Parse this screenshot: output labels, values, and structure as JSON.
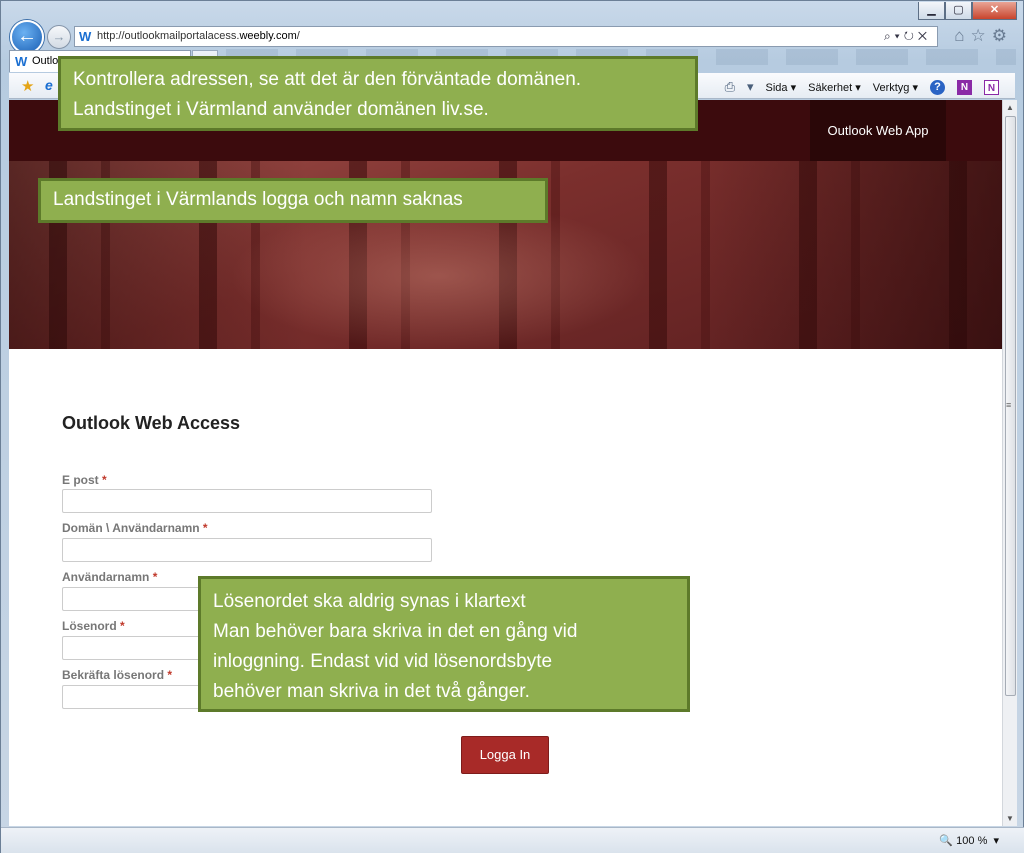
{
  "browser": {
    "url_prefix": "http://outlookmailportalacess.",
    "url_domain": "weebly.com",
    "url_suffix": "/",
    "tab_title": "Outlo",
    "commands": {
      "sida": "Sida ▾",
      "sakerhet": "Säkerhet ▾",
      "verktyg": "Verktyg ▾"
    },
    "zoom": "100 %"
  },
  "site": {
    "nav_link": "Outlook Web App"
  },
  "form": {
    "title": "Outlook Web Access",
    "required_mark": "*",
    "fields": [
      {
        "label": "E post"
      },
      {
        "label": "Domän \\ Användarnamn"
      },
      {
        "label": "Användarnamn"
      },
      {
        "label": "Lösenord"
      },
      {
        "label": "Bekräfta lösenord"
      }
    ],
    "submit": "Logga In"
  },
  "callouts": {
    "address": [
      "Kontrollera adressen, se att det är den förväntade domänen.",
      "Landstinget i  Värmland använder domänen liv.se."
    ],
    "logo": "Landstinget i Värmlands logga och namn saknas",
    "password": [
      "Lösenordet ska aldrig synas i klartext",
      "Man behöver bara skriva in det en gång vid",
      "inloggning. Endast vid vid lösenordsbyte",
      "behöver man skriva in det två gånger."
    ]
  },
  "colors": {
    "navbar": "#3c0b0d",
    "button": "#a82a28",
    "callout": "#8faf4f"
  }
}
